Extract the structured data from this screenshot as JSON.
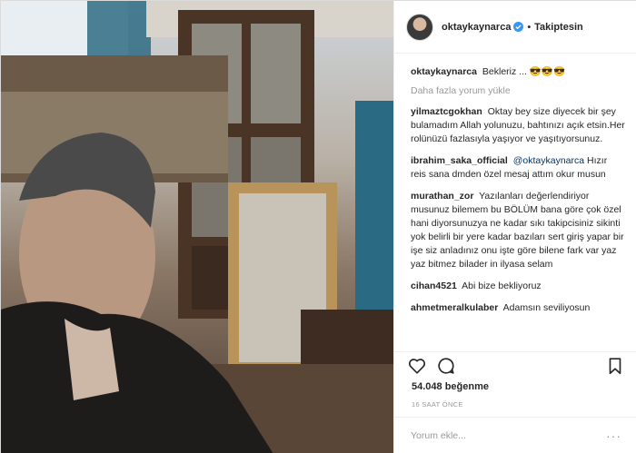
{
  "header": {
    "username": "oktaykaynarca",
    "separator": "•",
    "follow_label": "Takiptesin"
  },
  "caption": {
    "username": "oktaykaynarca",
    "text": "Bekleriz ... 😎😎😎"
  },
  "load_more": "Daha fazla yorum yükle",
  "comments": [
    {
      "username": "yilmaztcgokhan",
      "mention": "",
      "text": "Oktay bey size diyecek bir şey bulamadım Allah yolunuzu, bahtınızı açık etsin.Her rolünüzü fazlasıyla yaşıyor ve yaşıtıyorsunuz."
    },
    {
      "username": "ibrahim_saka_official",
      "mention": "@oktaykaynarca",
      "text": "Hızır reis sana dmden özel mesaj attım okur musun"
    },
    {
      "username": "murathan_zor",
      "mention": "",
      "text": "Yazılanları değerlendiriyor musunuz bilemem bu BÖLÜM bana göre çok özel hani diyorsunuzya ne kadar sıkı takipcisiniz sikinti yok belirli bir yere kadar bazıları sert giriş yapar bir işe siz anladınız onu işte göre bilene fark var yaz yaz bitmez bilader in ilyasa selam"
    },
    {
      "username": "cihan4521",
      "mention": "",
      "text": "Abi bize bekliyoruz"
    },
    {
      "username": "ahmetmeralkulaber",
      "mention": "",
      "text": "Adamsın seviliyosun"
    }
  ],
  "likes": "54.048 beğenme",
  "time": "16 SAAT ÖNCE",
  "add_comment": {
    "placeholder": "Yorum ekle...",
    "more": "···"
  },
  "icons": {
    "verified": "verified-badge-icon",
    "like": "heart-icon",
    "comment": "comment-bubble-icon",
    "save": "bookmark-icon"
  },
  "colors": {
    "verified_blue": "#3897f0",
    "text": "#262626",
    "muted": "#999999",
    "mention": "#003569"
  }
}
